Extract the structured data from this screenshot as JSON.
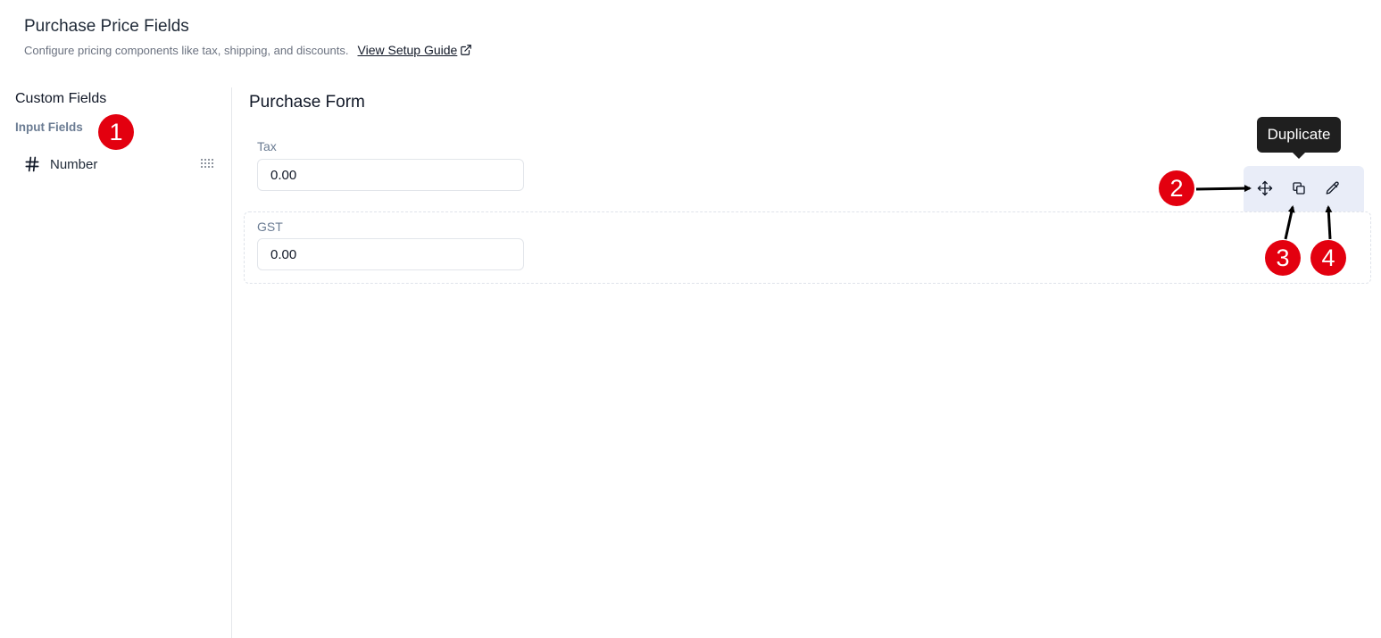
{
  "header": {
    "title": "Purchase Price Fields",
    "subtitle": "Configure pricing components like tax, shipping, and discounts.",
    "guide_link": "View Setup Guide"
  },
  "sidebar": {
    "title": "Custom Fields",
    "subtitle": "Input Fields",
    "items": [
      {
        "label": "Number",
        "icon": "hash-icon"
      }
    ]
  },
  "form": {
    "title": "Purchase Form",
    "fields": [
      {
        "label": "Tax",
        "value": "0.00"
      },
      {
        "label": "GST",
        "value": "0.00"
      }
    ]
  },
  "toolbar": {
    "tooltip": "Duplicate",
    "icons": [
      "move-icon",
      "duplicate-icon",
      "edit-icon"
    ]
  },
  "annotations": [
    "1",
    "2",
    "3",
    "4"
  ],
  "colors": {
    "badge": "#e3000f",
    "toolbar_bg": "#e9edf8",
    "tooltip_bg": "#1f1f1f"
  }
}
